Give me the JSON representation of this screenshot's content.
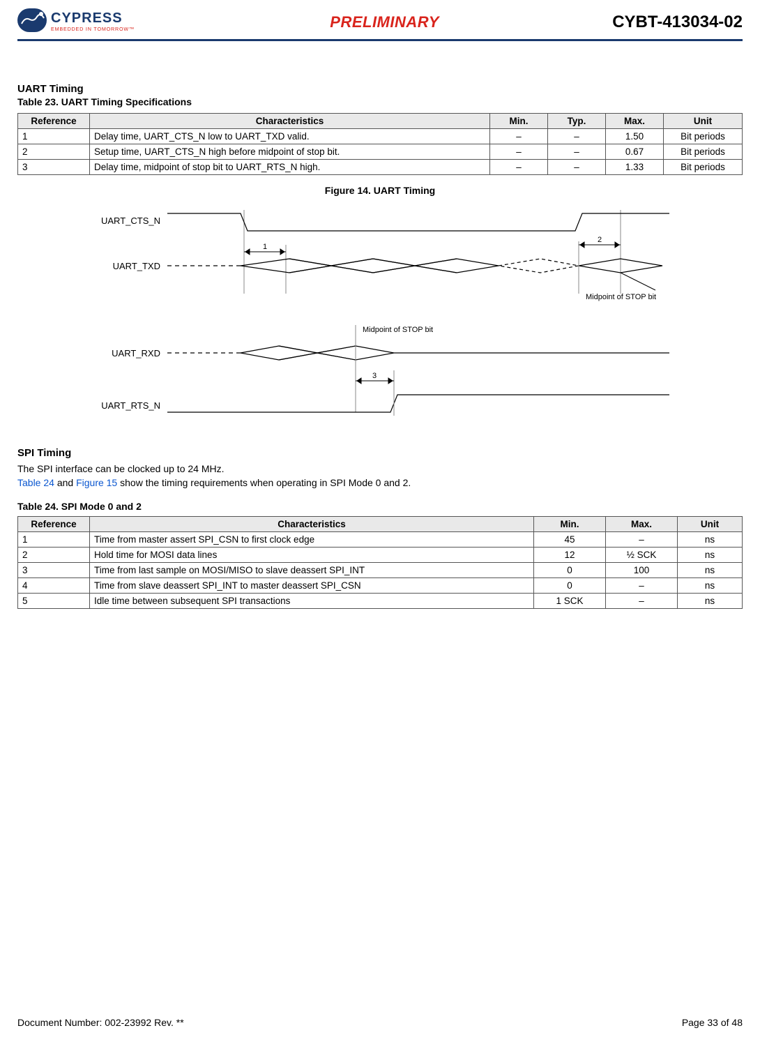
{
  "header": {
    "preliminary": "PRELIMINARY",
    "part_number": "CYBT-413034-02",
    "logo_text_main": "CYPRESS",
    "logo_text_sub": "EMBEDDED IN TOMORROW™"
  },
  "section_uart": {
    "heading": "UART Timing",
    "table_caption": "Table 23.  UART Timing Specifications",
    "headers": {
      "ref": "Reference",
      "char": "Characteristics",
      "min": "Min.",
      "typ": "Typ.",
      "max": "Max.",
      "unit": "Unit"
    },
    "rows": [
      {
        "ref": "1",
        "char": "Delay time, UART_CTS_N low to UART_TXD valid.",
        "min": "–",
        "typ": "–",
        "max": "1.50",
        "unit": "Bit periods"
      },
      {
        "ref": "2",
        "char": "Setup time, UART_CTS_N high before midpoint of stop bit.",
        "min": "–",
        "typ": "–",
        "max": "0.67",
        "unit": "Bit periods"
      },
      {
        "ref": "3",
        "char": "Delay time, midpoint of stop bit to UART_RTS_N high.",
        "min": "–",
        "typ": "–",
        "max": "1.33",
        "unit": "Bit periods"
      }
    ]
  },
  "figure14": {
    "caption": "Figure 14.  UART Timing",
    "labels": {
      "cts": "UART_CTS_N",
      "txd": "UART_TXD",
      "rxd": "UART_RXD",
      "rts": "UART_RTS_N",
      "mid_stop": "Midpoint of STOP bit",
      "m1": "1",
      "m2": "2",
      "m3": "3"
    }
  },
  "section_spi": {
    "heading": "SPI Timing",
    "line1": "The SPI interface can be clocked up to 24 MHz.",
    "line2a": "Table 24",
    "line2b": " and ",
    "line2c": "Figure 15",
    "line2d": " show the timing requirements when operating in SPI Mode 0 and 2.",
    "table_caption": "Table 24.  SPI Mode 0 and 2",
    "headers": {
      "ref": "Reference",
      "char": "Characteristics",
      "min": "Min.",
      "max": "Max.",
      "unit": "Unit"
    },
    "rows": [
      {
        "ref": "1",
        "char": "Time from master assert SPI_CSN to first clock edge",
        "min": "45",
        "max": "–",
        "unit": "ns"
      },
      {
        "ref": "2",
        "char": "Hold time for MOSI data lines",
        "min": "12",
        "max": "½ SCK",
        "unit": "ns"
      },
      {
        "ref": "3",
        "char": "Time from last sample on MOSI/MISO to slave deassert SPI_INT",
        "min": "0",
        "max": "100",
        "unit": "ns"
      },
      {
        "ref": "4",
        "char": "Time from slave deassert SPI_INT to master deassert SPI_CSN",
        "min": "0",
        "max": "–",
        "unit": "ns"
      },
      {
        "ref": "5",
        "char": "Idle time between subsequent SPI transactions",
        "min": "1 SCK",
        "max": "–",
        "unit": "ns"
      }
    ]
  },
  "footer": {
    "doc": "Document Number: 002-23992 Rev. **",
    "page": "Page 33 of 48"
  }
}
